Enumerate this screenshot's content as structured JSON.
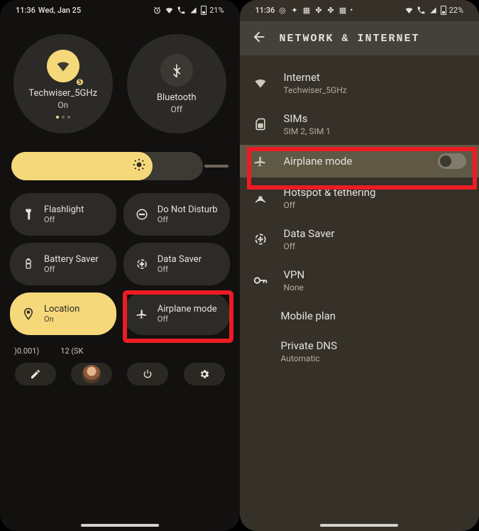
{
  "left": {
    "status": {
      "time": "11:36",
      "date": "Wed, Jan 25",
      "battery": "21%"
    },
    "big": [
      {
        "name": "wifi",
        "label": "Techwiser_5GHz",
        "sub": "On",
        "on": true
      },
      {
        "name": "bluetooth",
        "label": "Bluetooth",
        "sub": "Off",
        "on": false
      }
    ],
    "tiles": [
      [
        {
          "name": "flashlight",
          "label": "Flashlight",
          "sub": "Off",
          "on": false
        },
        {
          "name": "dnd",
          "label": "Do Not Disturb",
          "sub": "Off",
          "on": false
        }
      ],
      [
        {
          "name": "battery-saver",
          "label": "Battery Saver",
          "sub": "Off",
          "on": false
        },
        {
          "name": "data-saver",
          "label": "Data Saver",
          "sub": "Off",
          "on": false
        }
      ],
      [
        {
          "name": "location",
          "label": "Location",
          "sub": "On",
          "on": true
        },
        {
          "name": "airplane",
          "label": "Airplane mode",
          "sub": "Off",
          "on": false
        }
      ]
    ],
    "labels": {
      "a": ")0.001)",
      "b": "12 (SK"
    }
  },
  "right": {
    "status": {
      "time": "11:36",
      "battery": "22%"
    },
    "title": "NETWORK & INTERNET",
    "rows": [
      {
        "name": "internet",
        "label": "Internet",
        "sub": "Techwiser_5GHz"
      },
      {
        "name": "sims",
        "label": "SIMs",
        "sub": "SIM 2, SIM 1"
      },
      {
        "name": "airplane",
        "label": "Airplane mode",
        "sub": ""
      },
      {
        "name": "hotspot",
        "label": "Hotspot & tethering",
        "sub": "Off"
      },
      {
        "name": "data-saver",
        "label": "Data Saver",
        "sub": "Off"
      },
      {
        "name": "vpn",
        "label": "VPN",
        "sub": "None"
      },
      {
        "name": "mobile-plan",
        "label": "Mobile plan",
        "sub": ""
      },
      {
        "name": "private-dns",
        "label": "Private DNS",
        "sub": "Automatic"
      }
    ]
  }
}
